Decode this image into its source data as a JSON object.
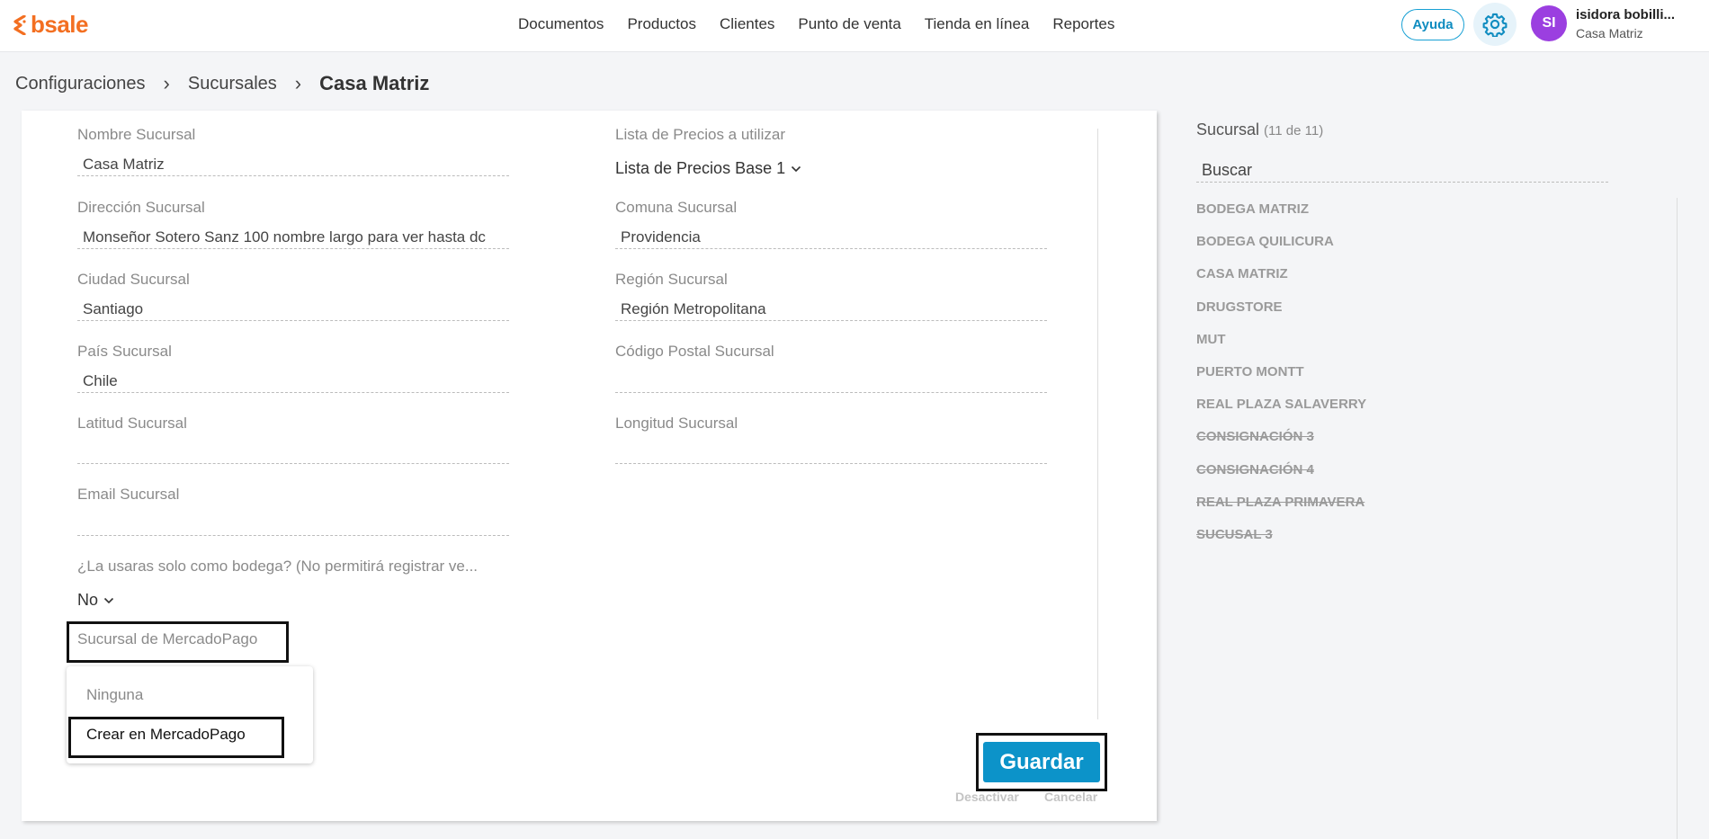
{
  "header": {
    "logo_text": "bsale",
    "nav": [
      "Documentos",
      "Productos",
      "Clientes",
      "Punto de venta",
      "Tienda en línea",
      "Reportes"
    ],
    "help_label": "Ayuda",
    "avatar_initials": "SI",
    "user_name": "isidora bobilli...",
    "user_branch": "Casa Matriz"
  },
  "breadcrumb": {
    "level1": "Configuraciones",
    "level2": "Sucursales",
    "current": "Casa Matriz",
    "separator": "›"
  },
  "form": {
    "nombre_label": "Nombre Sucursal",
    "nombre_value": "Casa Matriz",
    "lista_label": "Lista de Precios a utilizar",
    "lista_value": "Lista de Precios Base 1",
    "direccion_label": "Dirección Sucursal",
    "direccion_value": "Monseñor Sotero Sanz 100 nombre largo para ver hasta dc",
    "comuna_label": "Comuna Sucursal",
    "comuna_value": "Providencia",
    "ciudad_label": "Ciudad Sucursal",
    "ciudad_value": "Santiago",
    "region_label": "Región Sucursal",
    "region_value": "Región Metropolitana",
    "pais_label": "País Sucursal",
    "pais_value": "Chile",
    "postal_label": "Código Postal Sucursal",
    "postal_value": "",
    "latitud_label": "Latitud Sucursal",
    "latitud_value": "",
    "longitud_label": "Longitud Sucursal",
    "longitud_value": "",
    "email_label": "Email Sucursal",
    "email_value": "",
    "bodega_label": "¿La usaras solo como bodega? (No permitirá registrar ve...",
    "bodega_value": "No",
    "mercadopago_label": "Sucursal de MercadoPago",
    "mercadopago_options": [
      "Ninguna",
      "Crear en MercadoPago"
    ]
  },
  "actions": {
    "save": "Guardar",
    "deactivate": "Desactivar",
    "cancel": "Cancelar"
  },
  "branches_panel": {
    "title": "Sucursal",
    "count": "(11 de 11)",
    "search_value": "Buscar",
    "items": [
      {
        "name": "BODEGA MATRIZ",
        "inactive": false
      },
      {
        "name": "BODEGA QUILICURA",
        "inactive": false
      },
      {
        "name": "CASA MATRIZ",
        "inactive": false
      },
      {
        "name": "DRUGSTORE",
        "inactive": false
      },
      {
        "name": "MUT",
        "inactive": false
      },
      {
        "name": "PUERTO MONTT",
        "inactive": false
      },
      {
        "name": "REAL PLAZA SALAVERRY",
        "inactive": false
      },
      {
        "name": "CONSIGNACIÓN 3",
        "inactive": true
      },
      {
        "name": "CONSIGNACIÓN 4",
        "inactive": true
      },
      {
        "name": "REAL PLAZA PRIMAVERA",
        "inactive": true
      },
      {
        "name": "SUCUSAL 3",
        "inactive": true
      }
    ]
  },
  "colors": {
    "brand": "#f36f21",
    "primary": "#0c93c9",
    "avatar": "#9b3fe0"
  }
}
